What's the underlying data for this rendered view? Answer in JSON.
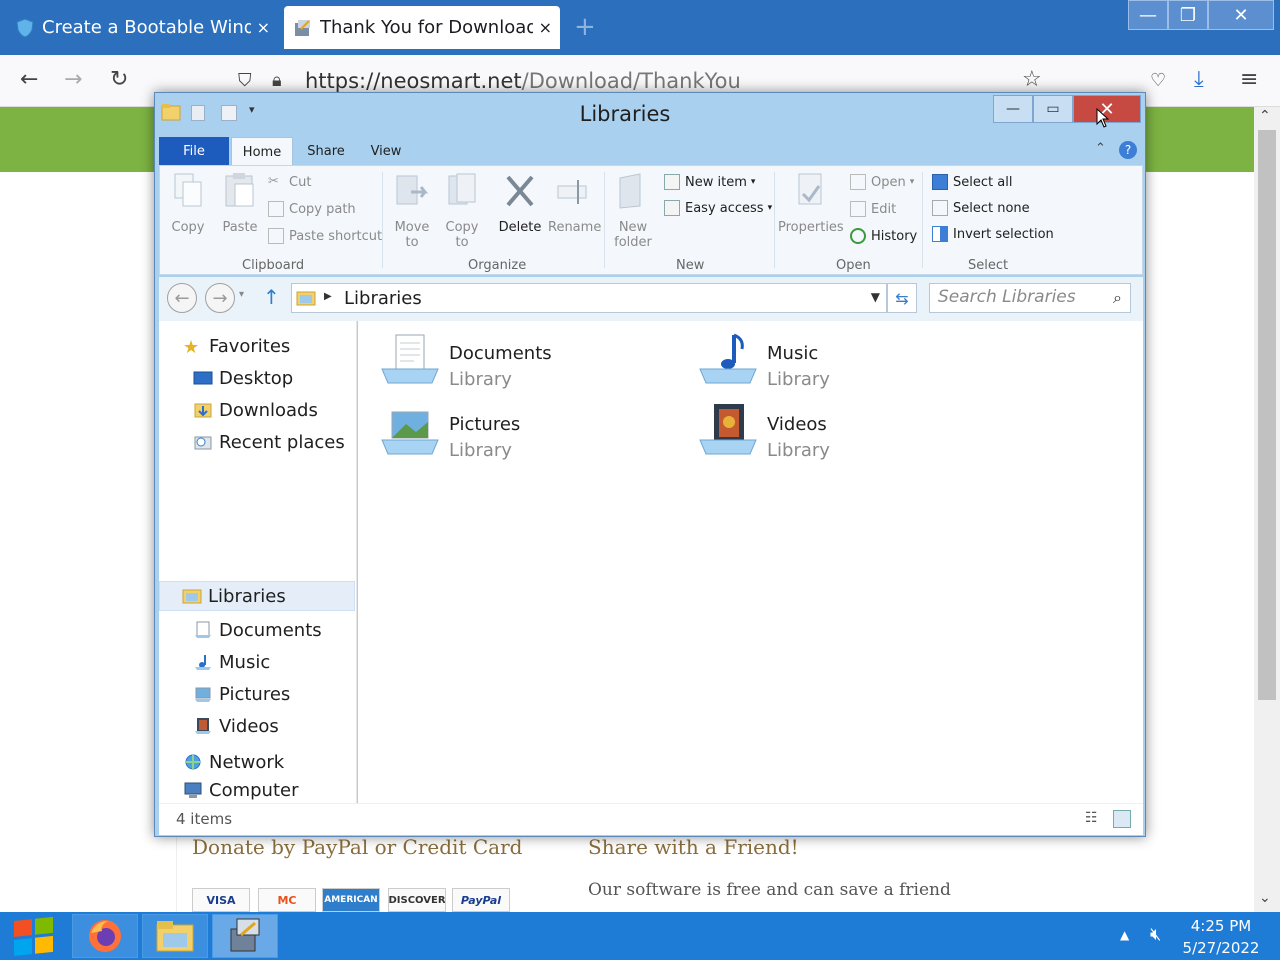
{
  "browser": {
    "tabs": [
      {
        "title": "Create a Bootable Windo",
        "active": false
      },
      {
        "title": "Thank You for Download",
        "active": true
      }
    ],
    "tab_close_glyph": "×",
    "new_tab_glyph": "+",
    "url_host": "https://neosmart.net",
    "url_path": "/Download/ThankYou",
    "window_controls": {
      "minimize": "—",
      "maximize": "❐",
      "close": "✕"
    }
  },
  "page": {
    "donate_heading": "Donate by PayPal or Credit Card",
    "share_heading": "Share with a Friend!",
    "share_text": "Our software is free and can save a friend",
    "cards": [
      "VISA",
      "MC",
      "AMERICAN",
      "DISCOVER",
      "PayPal"
    ]
  },
  "explorer": {
    "title": "Libraries",
    "window_controls": {
      "minimize": "—",
      "maximize": "▭",
      "close": "✕"
    },
    "ribbon_tabs": [
      "File",
      "Home",
      "Share",
      "View"
    ],
    "clipboard": {
      "copy": "Copy",
      "paste": "Paste",
      "cut": "Cut",
      "copy_path": "Copy path",
      "paste_shortcut": "Paste shortcut",
      "label": "Clipboard"
    },
    "organize": {
      "move_to": "Move to",
      "copy_to": "Copy to",
      "delete": "Delete",
      "rename": "Rename",
      "label": "Organize"
    },
    "new": {
      "new_folder": "New folder",
      "new_item": "New item",
      "easy_access": "Easy access",
      "label": "New"
    },
    "open": {
      "properties": "Properties",
      "open": "Open",
      "edit": "Edit",
      "history": "History",
      "label": "Open"
    },
    "select": {
      "select_all": "Select all",
      "select_none": "Select none",
      "invert_selection": "Invert selection",
      "label": "Select"
    },
    "address": "Libraries",
    "search_placeholder": "Search Libraries",
    "nav": {
      "favorites": "Favorites",
      "desktop": "Desktop",
      "downloads": "Downloads",
      "recent_places": "Recent places",
      "libraries": "Libraries",
      "documents": "Documents",
      "music": "Music",
      "pictures": "Pictures",
      "videos": "Videos",
      "computer": "Computer",
      "network": "Network"
    },
    "libraries": [
      {
        "name": "Documents",
        "type": "Library"
      },
      {
        "name": "Music",
        "type": "Library"
      },
      {
        "name": "Pictures",
        "type": "Library"
      },
      {
        "name": "Videos",
        "type": "Library"
      }
    ],
    "status": "4 items"
  },
  "taskbar": {
    "time": "4:25 PM",
    "date": "5/27/2022"
  },
  "colors": {
    "tabbar": "#2b6fbd",
    "page_green": "#7cb342",
    "taskbar": "#1e7bd6",
    "file_tab": "#1d5bbd",
    "close_red": "#c74a42"
  }
}
